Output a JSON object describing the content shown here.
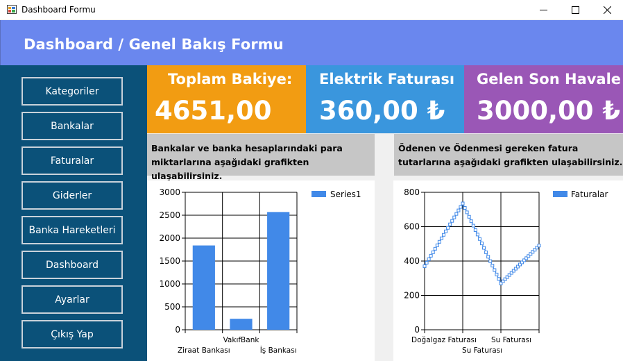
{
  "window": {
    "title": "Dashboard Formu",
    "controls": {
      "minimize": "—",
      "maximize": "☐",
      "close": "✕"
    }
  },
  "header": {
    "title": "Dashboard / Genel Bakış Formu"
  },
  "sidebar": {
    "items": [
      {
        "label": "Kategoriler"
      },
      {
        "label": "Bankalar"
      },
      {
        "label": "Faturalar"
      },
      {
        "label": "Giderler"
      },
      {
        "label": "Banka Hareketleri"
      },
      {
        "label": "Dashboard"
      },
      {
        "label": "Ayarlar"
      },
      {
        "label": "Çıkış Yap"
      }
    ]
  },
  "cards": {
    "bakiye": {
      "label": "Toplam Bakiye:",
      "value": "4651,00"
    },
    "elektrik": {
      "label": "Elektrik Faturası",
      "value": "360,00 ₺"
    },
    "havale": {
      "label": "Gelen Son Havale",
      "value": "3000,00 ₺"
    }
  },
  "descriptions": {
    "left": {
      "line1": "Bankalar ve banka hesaplarındaki para",
      "line2": "miktarlarına aşağıdaki grafikten ulaşabilirsiniz."
    },
    "right": {
      "line1": "Ödenen ve Ödenmesi gereken fatura",
      "line2": "tutarlarına aşağıdaki grafikten ulaşabilirsiniz."
    }
  },
  "colors": {
    "header": "#6a87ee",
    "sidebar": "#0b5179",
    "card_bakiye": "#f29c12",
    "card_elektrik": "#3a96dd",
    "card_havale": "#9a57b6",
    "series": "#4189e8"
  },
  "chart_data": [
    {
      "type": "bar",
      "categories": [
        "Ziraat Bankası",
        "VakıfBank",
        "İş Bankası"
      ],
      "series": [
        {
          "name": "Series1",
          "values": [
            1840,
            240,
            2570
          ]
        }
      ],
      "ylim": [
        0,
        3000
      ],
      "yticks": [
        0,
        500,
        1000,
        1500,
        2000,
        2500,
        3000
      ],
      "grid": true,
      "legend": "top-right"
    },
    {
      "type": "line",
      "categories": [
        "Doğalgaz Faturası",
        "Su Faturası",
        "Su Faturası"
      ],
      "series": [
        {
          "name": "Faturalar",
          "values": [
            370,
            735,
            270,
            490
          ]
        }
      ],
      "ylim": [
        0,
        800
      ],
      "yticks": [
        0,
        200,
        400,
        600,
        800
      ],
      "grid": true,
      "legend": "top-right"
    }
  ]
}
